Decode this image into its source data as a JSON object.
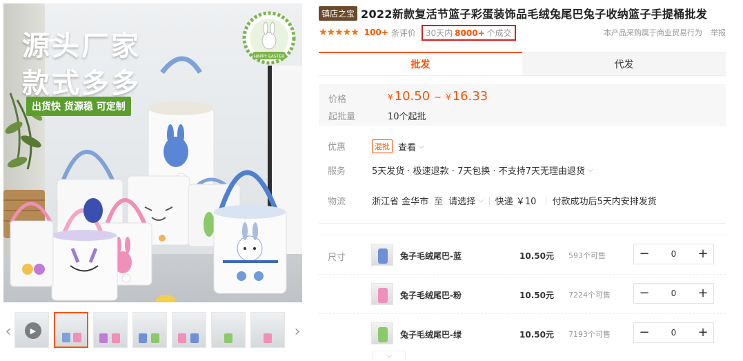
{
  "gallery": {
    "promo_lines": [
      "源头厂家",
      "款式多多"
    ],
    "promo_bar": "出货快 货源稳 可定制",
    "badge_text": "HAPPY EASTER",
    "thumbnails": [
      {
        "label": "video"
      },
      {
        "label": "image-2"
      },
      {
        "label": "image-3"
      },
      {
        "label": "image-4"
      },
      {
        "label": "image-5"
      },
      {
        "label": "image-6"
      },
      {
        "label": "image-7"
      }
    ]
  },
  "product": {
    "store_badge": "镇店之宝",
    "title": "2022新款复活节篮子彩蛋装饰品毛绒兔尾巴兔子收纳篮子手提桶批发",
    "stars": "★★★★★",
    "review_count": "100+",
    "review_text": "条评价",
    "sales_prefix": "30天内",
    "sales_count": "8000+",
    "sales_suffix": "个成交",
    "notice": "本产品采购属于商业贸易行为",
    "report": "举报"
  },
  "tabs": [
    {
      "label": "批发",
      "active": true
    },
    {
      "label": "代发",
      "active": false
    }
  ],
  "pricing": {
    "price_label": "价格",
    "currency": "¥",
    "price_low": "10.50",
    "price_sep": "~",
    "price_high": "16.33",
    "moq_label": "起批量",
    "moq_value": "10个起批"
  },
  "promo": {
    "label": "优惠",
    "badge": "混批",
    "action": "查看"
  },
  "service": {
    "label": "服务",
    "text": "5天发货 · 极速退款 · 7天包换 · 不支持7天无理由退货"
  },
  "logistics": {
    "label": "物流",
    "origin": "浙江省 金华市",
    "to": "至",
    "destination": "请选择",
    "shipping": "快递 ￥10",
    "dispatch": "付款成功后5天内安排发货"
  },
  "skus": {
    "label": "尺寸",
    "items": [
      {
        "name": "兔子毛绒尾巴-蓝",
        "price": "10.50元",
        "stock": "593个可售",
        "qty": "0",
        "color": "#6f8fd6"
      },
      {
        "name": "兔子毛绒尾巴-粉",
        "price": "10.50元",
        "stock": "7224个可售",
        "qty": "0",
        "color": "#f08fb8"
      },
      {
        "name": "兔子毛绒尾巴-绿",
        "price": "10.50元",
        "stock": "7193个可售",
        "qty": "0",
        "color": "#8cc96a"
      }
    ]
  },
  "colors": {
    "accent": "#ff5000",
    "highlight_border": "#e01b1b",
    "store_badge_bg": "#6b4a2a"
  }
}
